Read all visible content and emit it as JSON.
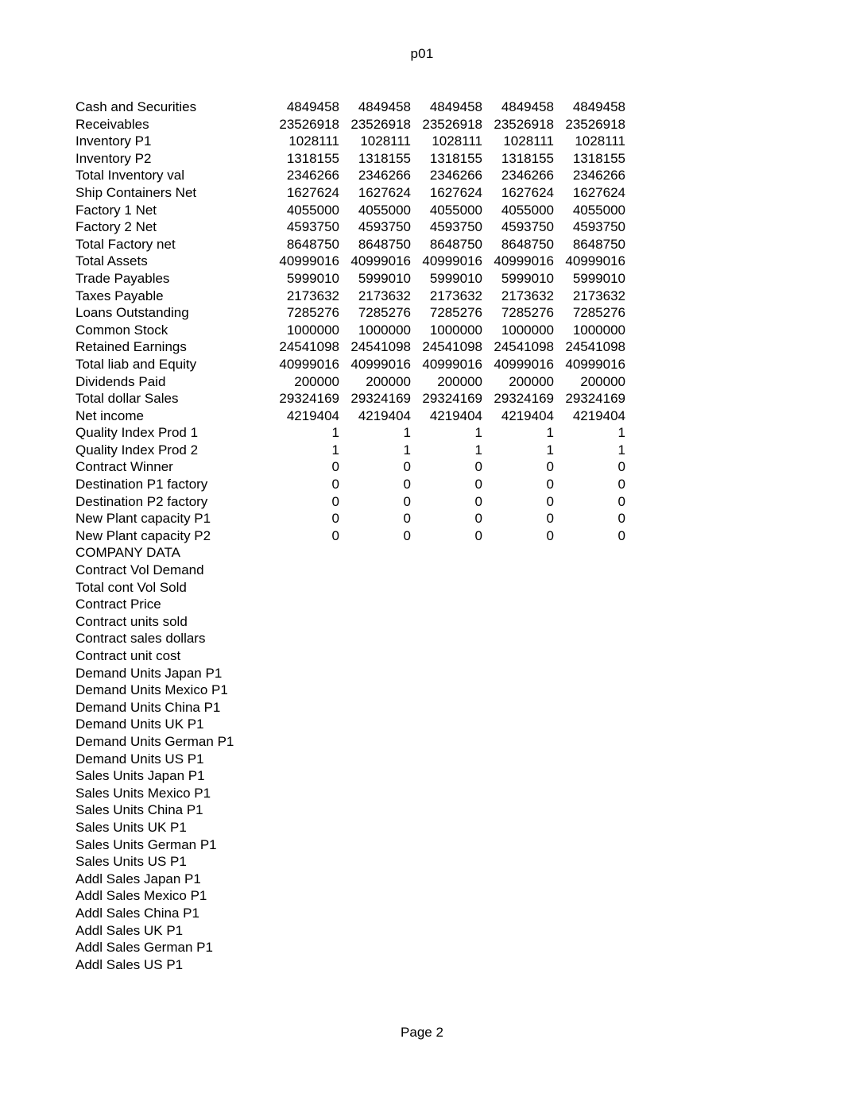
{
  "header": {
    "title": "p01"
  },
  "footer": {
    "page_label": "Page 2"
  },
  "table": {
    "rows": [
      {
        "label": "Cash and Securities",
        "values": [
          "4849458",
          "4849458",
          "4849458",
          "4849458",
          "4849458"
        ]
      },
      {
        "label": "Receivables",
        "values": [
          "23526918",
          "23526918",
          "23526918",
          "23526918",
          "23526918"
        ]
      },
      {
        "label": "Inventory P1",
        "values": [
          "1028111",
          "1028111",
          "1028111",
          "1028111",
          "1028111"
        ]
      },
      {
        "label": "Inventory P2",
        "values": [
          "1318155",
          "1318155",
          "1318155",
          "1318155",
          "1318155"
        ]
      },
      {
        "label": "Total  Inventory val",
        "values": [
          "2346266",
          "2346266",
          "2346266",
          "2346266",
          "2346266"
        ]
      },
      {
        "label": "Ship Containers Net",
        "values": [
          "1627624",
          "1627624",
          "1627624",
          "1627624",
          "1627624"
        ]
      },
      {
        "label": "Factory 1 Net",
        "values": [
          "4055000",
          "4055000",
          "4055000",
          "4055000",
          "4055000"
        ]
      },
      {
        "label": "Factory 2 Net",
        "values": [
          "4593750",
          "4593750",
          "4593750",
          "4593750",
          "4593750"
        ]
      },
      {
        "label": "Total Factory net",
        "values": [
          "8648750",
          "8648750",
          "8648750",
          "8648750",
          "8648750"
        ]
      },
      {
        "label": "Total Assets",
        "values": [
          "40999016",
          "40999016",
          "40999016",
          "40999016",
          "40999016"
        ]
      },
      {
        "label": "Trade Payables",
        "values": [
          "5999010",
          "5999010",
          "5999010",
          "5999010",
          "5999010"
        ]
      },
      {
        "label": "Taxes Payable",
        "values": [
          "2173632",
          "2173632",
          "2173632",
          "2173632",
          "2173632"
        ]
      },
      {
        "label": "Loans Outstanding",
        "values": [
          "7285276",
          "7285276",
          "7285276",
          "7285276",
          "7285276"
        ]
      },
      {
        "label": "Common Stock",
        "values": [
          "1000000",
          "1000000",
          "1000000",
          "1000000",
          "1000000"
        ]
      },
      {
        "label": "Retained Earnings",
        "values": [
          "24541098",
          "24541098",
          "24541098",
          "24541098",
          "24541098"
        ]
      },
      {
        "label": "Total liab and Equity",
        "values": [
          "40999016",
          "40999016",
          "40999016",
          "40999016",
          "40999016"
        ]
      },
      {
        "label": "Dividends Paid",
        "values": [
          "200000",
          "200000",
          "200000",
          "200000",
          "200000"
        ]
      },
      {
        "label": "Total dollar Sales",
        "values": [
          "29324169",
          "29324169",
          "29324169",
          "29324169",
          "29324169"
        ]
      },
      {
        "label": "Net income",
        "values": [
          "4219404",
          "4219404",
          "4219404",
          "4219404",
          "4219404"
        ]
      },
      {
        "label": "Quality Index Prod 1",
        "values": [
          "1",
          "1",
          "1",
          "1",
          "1"
        ]
      },
      {
        "label": "Quality Index Prod 2",
        "values": [
          "1",
          "1",
          "1",
          "1",
          "1"
        ]
      },
      {
        "label": "Contract Winner",
        "values": [
          "0",
          "0",
          "0",
          "0",
          "0"
        ]
      },
      {
        "label": "Destination P1 factory",
        "values": [
          "0",
          "0",
          "0",
          "0",
          "0"
        ]
      },
      {
        "label": "Destination P2 factory",
        "values": [
          "0",
          "0",
          "0",
          "0",
          "0"
        ]
      },
      {
        "label": "New Plant capacity P1",
        "values": [
          "0",
          "0",
          "0",
          "0",
          "0"
        ]
      },
      {
        "label": "New Plant capacity P2",
        "values": [
          "0",
          "0",
          "0",
          "0",
          "0"
        ]
      },
      {
        "label": "COMPANY DATA",
        "values": [
          "",
          "",
          "",
          "",
          ""
        ]
      },
      {
        "label": "Contract Vol Demand",
        "values": [
          "",
          "",
          "",
          "",
          ""
        ]
      },
      {
        "label": "Total cont Vol Sold",
        "values": [
          "",
          "",
          "",
          "",
          ""
        ]
      },
      {
        "label": "Contract Price",
        "values": [
          "",
          "",
          "",
          "",
          ""
        ]
      },
      {
        "label": "Contract units sold",
        "values": [
          "",
          "",
          "",
          "",
          ""
        ]
      },
      {
        "label": "Contract sales dollars",
        "values": [
          "",
          "",
          "",
          "",
          ""
        ]
      },
      {
        "label": "Contract unit cost",
        "values": [
          "",
          "",
          "",
          "",
          ""
        ]
      },
      {
        "label": "Demand  Units Japan P1",
        "values": [
          "",
          "",
          "",
          "",
          ""
        ]
      },
      {
        "label": "Demand  Units Mexico P1",
        "values": [
          "",
          "",
          "",
          "",
          ""
        ]
      },
      {
        "label": "Demand  Units China P1",
        "values": [
          "",
          "",
          "",
          "",
          ""
        ]
      },
      {
        "label": "Demand  Units UK P1",
        "values": [
          "",
          "",
          "",
          "",
          ""
        ]
      },
      {
        "label": "Demand  Units German P1",
        "values": [
          "",
          "",
          "",
          "",
          ""
        ]
      },
      {
        "label": "Demand  Units US P1",
        "values": [
          "",
          "",
          "",
          "",
          ""
        ]
      },
      {
        "label": "Sales Units Japan P1",
        "values": [
          "",
          "",
          "",
          "",
          ""
        ]
      },
      {
        "label": "Sales Units Mexico P1",
        "values": [
          "",
          "",
          "",
          "",
          ""
        ]
      },
      {
        "label": "Sales Units China P1",
        "values": [
          "",
          "",
          "",
          "",
          ""
        ]
      },
      {
        "label": "Sales Units UK P1",
        "values": [
          "",
          "",
          "",
          "",
          ""
        ]
      },
      {
        "label": "Sales Units German P1",
        "values": [
          "",
          "",
          "",
          "",
          ""
        ]
      },
      {
        "label": "Sales Units US P1",
        "values": [
          "",
          "",
          "",
          "",
          ""
        ]
      },
      {
        "label": "Addl Sales Japan P1",
        "values": [
          "",
          "",
          "",
          "",
          ""
        ]
      },
      {
        "label": "Addl Sales Mexico P1",
        "values": [
          "",
          "",
          "",
          "",
          ""
        ]
      },
      {
        "label": "Addl Sales China P1",
        "values": [
          "",
          "",
          "",
          "",
          ""
        ]
      },
      {
        "label": "Addl Sales UK P1",
        "values": [
          "",
          "",
          "",
          "",
          ""
        ]
      },
      {
        "label": "Addl Sales German P1",
        "values": [
          "",
          "",
          "",
          "",
          ""
        ]
      },
      {
        "label": "Addl Sales US P1",
        "values": [
          "",
          "",
          "",
          "",
          ""
        ]
      }
    ]
  }
}
